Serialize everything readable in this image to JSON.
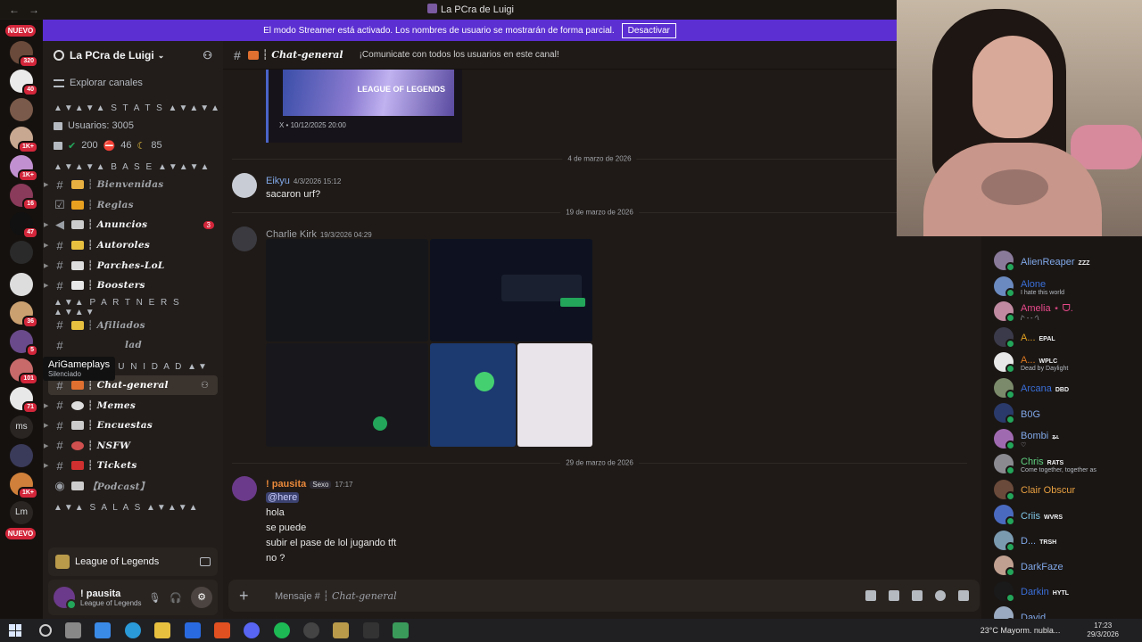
{
  "window": {
    "title": "La PCra de Luigi"
  },
  "banner": {
    "text": "El modo Streamer está activado. Los nombres de usuario se mostrarán de forma parcial.",
    "button": "Desactivar"
  },
  "rail": {
    "pill_top": "NUEVO",
    "pill_bottom": "NUEVO",
    "badges": [
      "320",
      "40",
      "1K+",
      "1K+",
      "16",
      "47",
      "36",
      "5",
      "101",
      "71",
      "1K+"
    ],
    "text_servers": [
      "ms",
      "Lm"
    ]
  },
  "sidebar": {
    "server_name": "La PCra de Luigi",
    "explore": "Explorar canales",
    "cat_stats": "▲▼▲▼▲ S T A T S ▲▼▲▼▲",
    "stat_users": "Usuarios: 3005",
    "stat_green": "200",
    "stat_red": "46",
    "stat_moon": "85",
    "cat_base": "▲▼▲▼▲ B A S E ▲▼▲▼▲",
    "ch_bienvenidas": "┆ Bienvenidas",
    "ch_reglas": "┆ Reglas",
    "ch_anuncios": "┆ Anuncios",
    "ch_anuncios_badge": "3",
    "ch_autoroles": "┆ Autoroles",
    "ch_parches": "┆ Parches-LoL",
    "ch_boosters": "┆ Boosters",
    "cat_partners": "▲▼▲ P A R T N E R S ▲▼▲▼",
    "ch_afiliados": "┆ Afiliados",
    "ch_partial": "lad",
    "cat_comunidad": "▲▼ C O M U N I D A D ▲▼",
    "ch_chat_general": "┆ Chat-general",
    "ch_memes": "┆ Memes",
    "ch_encuestas": "┆ Encuestas",
    "ch_nsfw": "┆ NSFW",
    "ch_tickets": "┆ Tickets",
    "ch_podcast": "【Podcast】",
    "cat_salas": "▲▼▲ S A L A S ▲▼▲▼▲",
    "tooltip_name": "AriGameplays",
    "tooltip_status": "Silenciado",
    "voice_label": "League of Legends",
    "user_name": "! pausita",
    "user_status": "League of Legends"
  },
  "chat": {
    "channel": "┆ Chat-general",
    "topic": "¡Comunicate con todos los usuarios en este canal!",
    "embed_footer": "X • 10/12/2025 20:00",
    "embed_game": "LEAGUE OF LEGENDS",
    "divider1": "4 de marzo de 2026",
    "msg1": {
      "author": "Eikyu",
      "time": "4/3/2026 15:12",
      "lines": [
        "sacaron urf?"
      ]
    },
    "divider2": "19 de marzo de 2026",
    "msg2": {
      "author": "Charlie Kirk",
      "time": "19/3/2026 04:29"
    },
    "divider3": "29 de marzo de 2026",
    "msg3": {
      "author": "! pausita",
      "tag": "Sexo",
      "time": "17:17",
      "mention": "@here",
      "lines": [
        "hola",
        "se puede",
        "subir el pase de lol jugando tft",
        "no ?"
      ]
    },
    "composer_prefix": "Mensaje #",
    "composer_channel": "┆ Chat-general"
  },
  "members": [
    {
      "name": "AlienReaper",
      "tag": "ZZZ",
      "status": "",
      "color": "#80a8e8"
    },
    {
      "name": "Alone",
      "tag": "",
      "status": "I hate this world",
      "color": "#3a6fd8"
    },
    {
      "name": "Amelia ⋆ ᗜ.",
      "tag": "",
      "status": "/ᐠ - - ᐟ\\",
      "color": "#e84a8a"
    },
    {
      "name": "A...",
      "tag": "EPAL",
      "status": "",
      "color": "#e0a020"
    },
    {
      "name": "A...",
      "tag": "WPLC",
      "status": "Dead by Daylight",
      "color": "#e07a20"
    },
    {
      "name": "Arcana",
      "tag": "DBD",
      "status": "",
      "color": "#3a6fd8"
    },
    {
      "name": "B0G",
      "tag": "",
      "status": "",
      "color": "#80a8e8"
    },
    {
      "name": "Bombi",
      "tag": "ʑʟ",
      "status": "♡",
      "color": "#80a8e8"
    },
    {
      "name": "Chris",
      "tag": "RATS",
      "status": "Come together, together as",
      "color": "#60d080"
    },
    {
      "name": "Clair Obscur",
      "tag": "",
      "status": "",
      "color": "#e8a040"
    },
    {
      "name": "Criis",
      "tag": "WVRS",
      "status": "",
      "color": "#80c8e8"
    },
    {
      "name": "D...",
      "tag": "TRSH",
      "status": "",
      "color": "#80a8e8"
    },
    {
      "name": "DarkFaze",
      "tag": "",
      "status": "",
      "color": "#80a8e8"
    },
    {
      "name": "Darkin",
      "tag": "HYTL",
      "status": "",
      "color": "#3a6fd8"
    },
    {
      "name": "David",
      "tag": "",
      "status": "",
      "color": "#80a8e8"
    }
  ],
  "taskbar": {
    "weather": "23°C  Mayorm. nubla...",
    "time": "17:23",
    "date": "29/3/2026"
  }
}
